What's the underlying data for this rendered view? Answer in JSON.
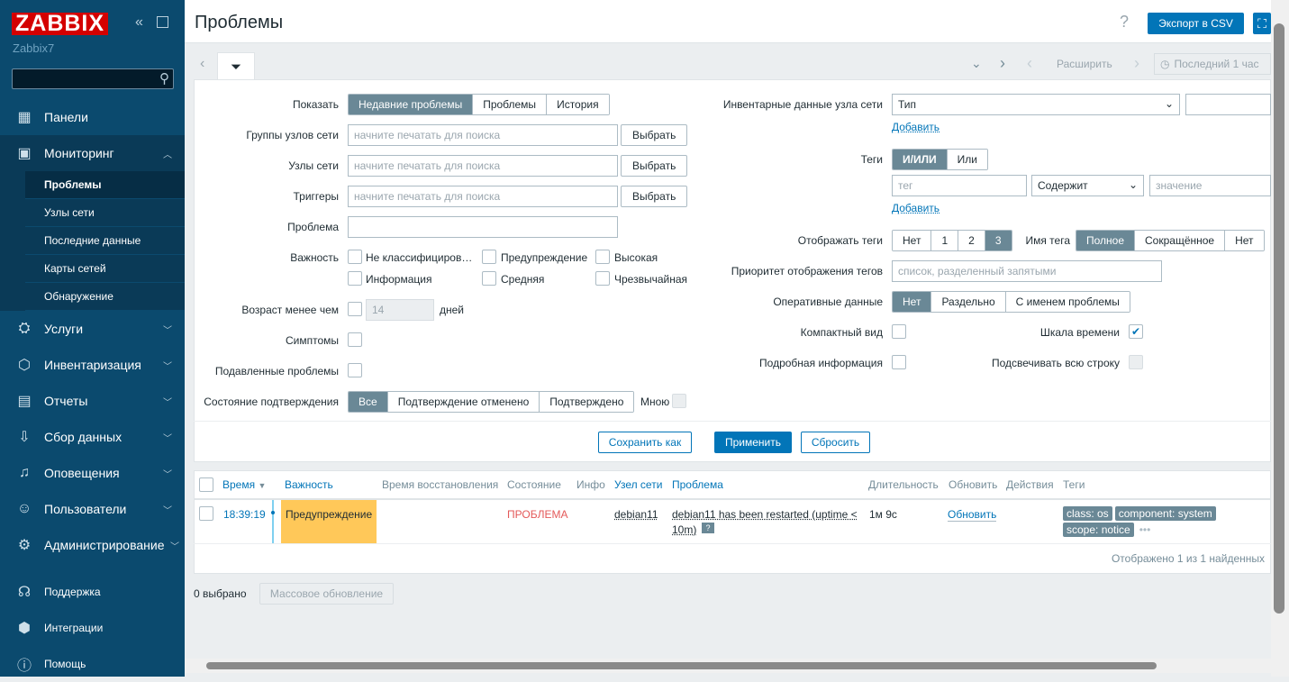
{
  "sidebar": {
    "logo": "ZABBIX",
    "server": "Zabbix7",
    "items": [
      {
        "label": "Панели",
        "icon": "dashboard-icon"
      },
      {
        "label": "Мониторинг",
        "icon": "monitoring-icon"
      },
      {
        "label": "Услуги",
        "icon": "services-icon"
      },
      {
        "label": "Инвентаризация",
        "icon": "inventory-icon"
      },
      {
        "label": "Отчеты",
        "icon": "reports-icon"
      },
      {
        "label": "Сбор данных",
        "icon": "data-collection-icon"
      },
      {
        "label": "Оповещения",
        "icon": "alerts-icon"
      },
      {
        "label": "Пользователи",
        "icon": "users-icon"
      },
      {
        "label": "Администрирование",
        "icon": "admin-icon"
      }
    ],
    "submenu": [
      "Проблемы",
      "Узлы сети",
      "Последние данные",
      "Карты сетей",
      "Обнаружение"
    ],
    "bottom": [
      "Поддержка",
      "Интеграции",
      "Помощь"
    ]
  },
  "header": {
    "title": "Проблемы",
    "help": "?",
    "export": "Экспорт в CSV"
  },
  "timebar": {
    "zoom_out": "Расширить",
    "period": "Последний 1 час"
  },
  "filter": {
    "show_label": "Показать",
    "show_options": [
      "Недавние проблемы",
      "Проблемы",
      "История"
    ],
    "hostgroups_label": "Группы узлов сети",
    "hosts_label": "Узлы сети",
    "triggers_label": "Триггеры",
    "placeholder": "начните печатать для поиска",
    "select": "Выбрать",
    "problem_label": "Проблема",
    "severity_label": "Важность",
    "severities": [
      "Не классифициров…",
      "Предупреждение",
      "Высокая",
      "Информация",
      "Средняя",
      "Чрезвычайная"
    ],
    "age_label": "Возраст менее чем",
    "age_value": "14",
    "age_unit": "дней",
    "symptoms_label": "Симптомы",
    "suppressed_label": "Подавленные проблемы",
    "ack_label": "Состояние подтверждения",
    "ack_options": [
      "Все",
      "Подтверждение отменено",
      "Подтверждено"
    ],
    "by_me": "Мною",
    "inventory_label": "Инвентарные данные узла сети",
    "inventory_select": "Тип",
    "add": "Добавить",
    "tags_label": "Теги",
    "tags_ops": [
      "И/ИЛИ",
      "Или"
    ],
    "tag_placeholder": "тег",
    "tag_operator": "Содержит",
    "value_placeholder": "значение",
    "show_tags_label": "Отображать теги",
    "show_tags_options": [
      "Нет",
      "1",
      "2",
      "3"
    ],
    "tag_name_label": "Имя тега",
    "tag_name_options": [
      "Полное",
      "Сокращённое",
      "Нет"
    ],
    "tag_priority_label": "Приоритет отображения тегов",
    "tag_priority_placeholder": "список, разделенный запятыми",
    "opdata_label": "Оперативные данные",
    "opdata_options": [
      "Нет",
      "Раздельно",
      "С именем проблемы"
    ],
    "compact_label": "Компактный вид",
    "timeline_label": "Шкала времени",
    "details_label": "Подробная информация",
    "highlight_label": "Подсвечивать всю строку",
    "save_as": "Сохранить как",
    "apply": "Применить",
    "reset": "Сбросить"
  },
  "table": {
    "headers": [
      "Время",
      "Важность",
      "Время восстановления",
      "Состояние",
      "Инфо",
      "Узел сети",
      "Проблема",
      "Длительность",
      "Обновить",
      "Действия",
      "Теги"
    ],
    "rows": [
      {
        "time": "18:39:19",
        "severity": "Предупреждение",
        "status": "ПРОБЛЕМА",
        "host": "debian11",
        "problem": "debian11 has been restarted (uptime <",
        "problem2": "10m)",
        "duration": "1м 9с",
        "update": "Обновить",
        "tags": [
          "class: os",
          "component: system",
          "scope: notice"
        ]
      }
    ],
    "footer": "Отображено 1 из 1 найденных"
  },
  "bottom": {
    "selected": "0 выбрано",
    "mass_update": "Массовое обновление"
  },
  "colors": {
    "sidebar": "#0b4a6e",
    "accent": "#0275b8",
    "warning": "#ffc859",
    "problem": "#e45959"
  }
}
